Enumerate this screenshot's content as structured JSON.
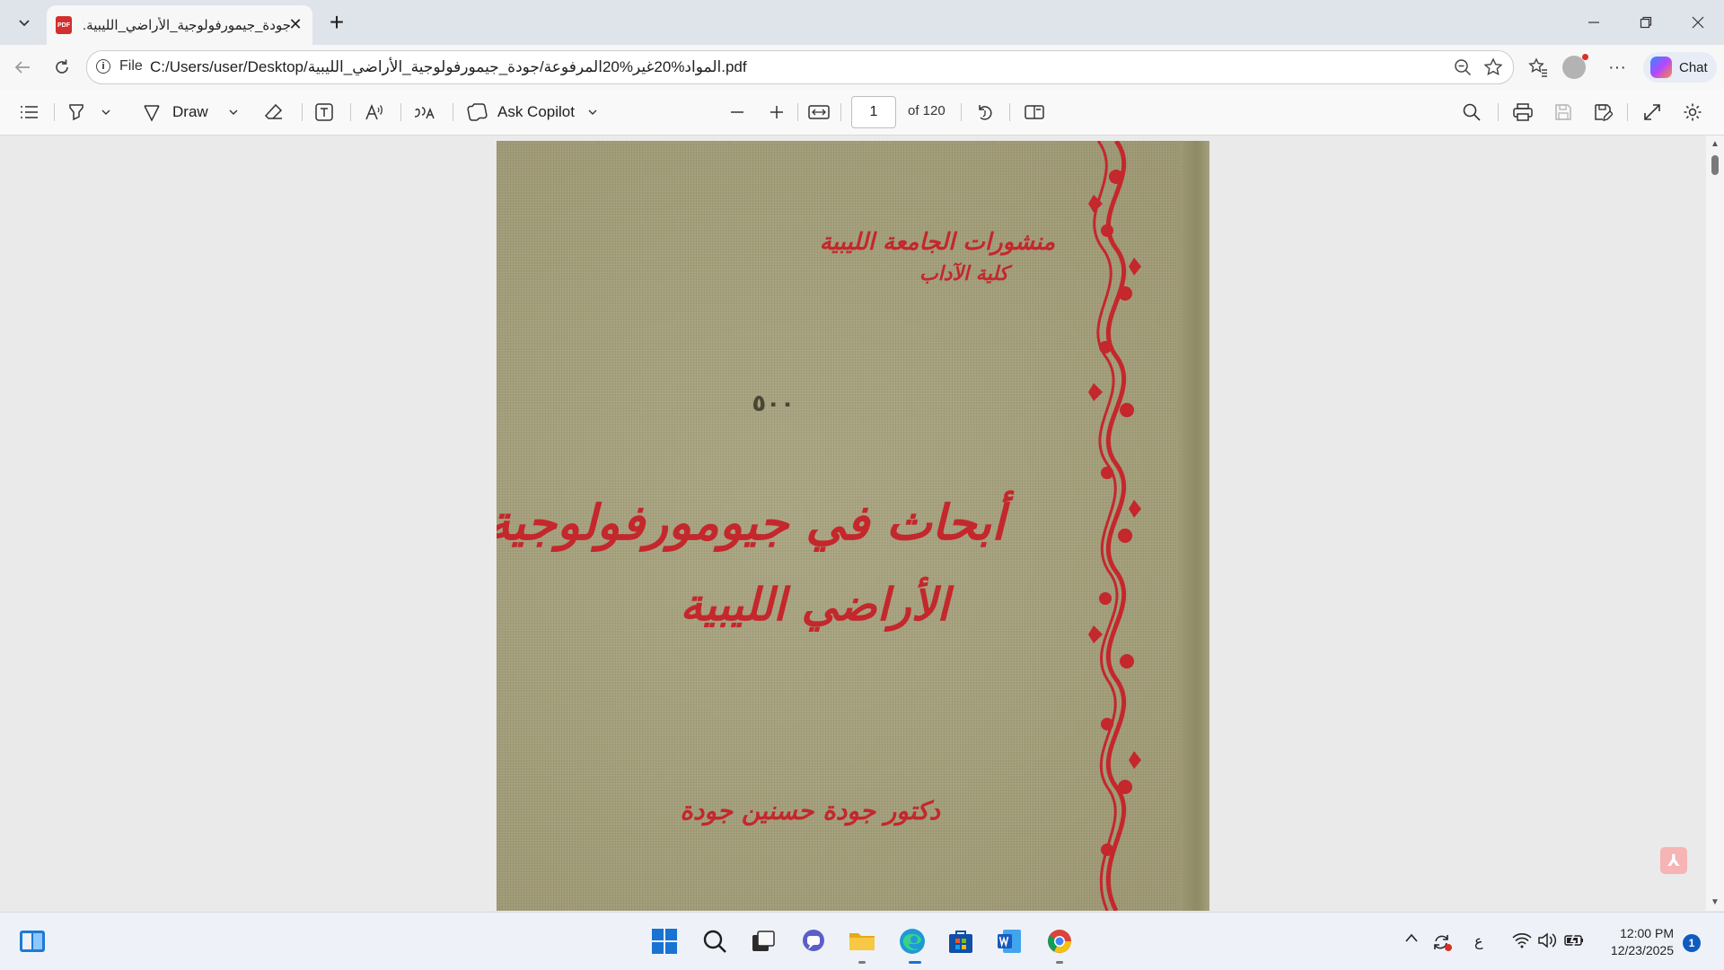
{
  "browser": {
    "tab": {
      "title": "جودة_جيمورفولوجية_الأراضي_الليبية.pdf",
      "icon": "pdf-file-icon"
    },
    "window_controls": [
      "minimize-icon",
      "restore-icon",
      "close-icon"
    ],
    "address_bar": {
      "scheme_label": "File",
      "url": "C:/Users/user/Desktop/المواد%20غير%20المرفوعة/جودة_جيمورفولوجية_الأراضي_الليبية.pdf"
    },
    "chat_label": "Chat"
  },
  "pdf_toolbar": {
    "draw_label": "Draw",
    "ask_copilot_label": "Ask Copilot",
    "page_number": "1",
    "page_count_label": "of 120"
  },
  "document": {
    "publisher": "منشورات الجامعة الليبية",
    "faculty": "كلية الآداب",
    "number": "٥٠٠",
    "title_line1": "أبحاث في جيومورفولوجية",
    "title_line2": "الأراضي الليبية",
    "author": "دكتور جودة حسنين جودة"
  },
  "taskbar": {
    "input_language": "ع",
    "time": "12:00 PM",
    "date": "12/23/2025",
    "notification_count": "1"
  },
  "colors": {
    "cover_background": "#a6a27e",
    "cover_ink": "#c4272c",
    "accent": "#0f5cc0"
  }
}
